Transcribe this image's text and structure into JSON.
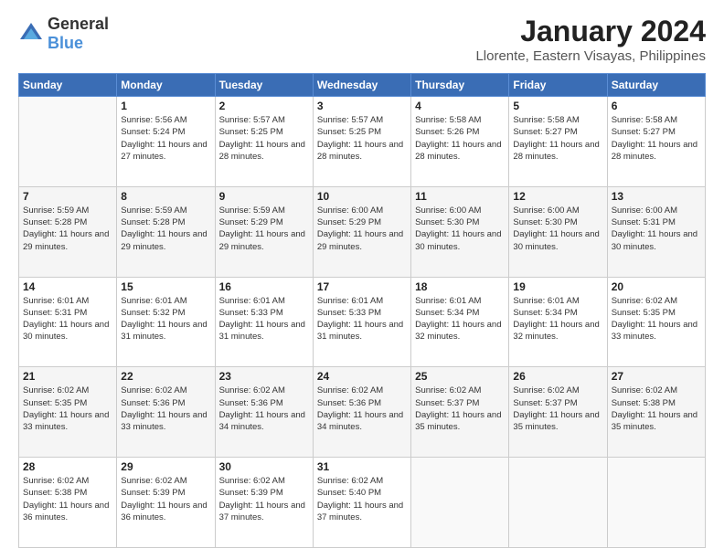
{
  "logo": {
    "general": "General",
    "blue": "Blue"
  },
  "header": {
    "title": "January 2024",
    "location": "Llorente, Eastern Visayas, Philippines"
  },
  "weekdays": [
    "Sunday",
    "Monday",
    "Tuesday",
    "Wednesday",
    "Thursday",
    "Friday",
    "Saturday"
  ],
  "weeks": [
    [
      {
        "day": "",
        "sunrise": "",
        "sunset": "",
        "daylight": ""
      },
      {
        "day": "1",
        "sunrise": "Sunrise: 5:56 AM",
        "sunset": "Sunset: 5:24 PM",
        "daylight": "Daylight: 11 hours and 27 minutes."
      },
      {
        "day": "2",
        "sunrise": "Sunrise: 5:57 AM",
        "sunset": "Sunset: 5:25 PM",
        "daylight": "Daylight: 11 hours and 28 minutes."
      },
      {
        "day": "3",
        "sunrise": "Sunrise: 5:57 AM",
        "sunset": "Sunset: 5:25 PM",
        "daylight": "Daylight: 11 hours and 28 minutes."
      },
      {
        "day": "4",
        "sunrise": "Sunrise: 5:58 AM",
        "sunset": "Sunset: 5:26 PM",
        "daylight": "Daylight: 11 hours and 28 minutes."
      },
      {
        "day": "5",
        "sunrise": "Sunrise: 5:58 AM",
        "sunset": "Sunset: 5:27 PM",
        "daylight": "Daylight: 11 hours and 28 minutes."
      },
      {
        "day": "6",
        "sunrise": "Sunrise: 5:58 AM",
        "sunset": "Sunset: 5:27 PM",
        "daylight": "Daylight: 11 hours and 28 minutes."
      }
    ],
    [
      {
        "day": "7",
        "sunrise": "Sunrise: 5:59 AM",
        "sunset": "Sunset: 5:28 PM",
        "daylight": "Daylight: 11 hours and 29 minutes."
      },
      {
        "day": "8",
        "sunrise": "Sunrise: 5:59 AM",
        "sunset": "Sunset: 5:28 PM",
        "daylight": "Daylight: 11 hours and 29 minutes."
      },
      {
        "day": "9",
        "sunrise": "Sunrise: 5:59 AM",
        "sunset": "Sunset: 5:29 PM",
        "daylight": "Daylight: 11 hours and 29 minutes."
      },
      {
        "day": "10",
        "sunrise": "Sunrise: 6:00 AM",
        "sunset": "Sunset: 5:29 PM",
        "daylight": "Daylight: 11 hours and 29 minutes."
      },
      {
        "day": "11",
        "sunrise": "Sunrise: 6:00 AM",
        "sunset": "Sunset: 5:30 PM",
        "daylight": "Daylight: 11 hours and 30 minutes."
      },
      {
        "day": "12",
        "sunrise": "Sunrise: 6:00 AM",
        "sunset": "Sunset: 5:30 PM",
        "daylight": "Daylight: 11 hours and 30 minutes."
      },
      {
        "day": "13",
        "sunrise": "Sunrise: 6:00 AM",
        "sunset": "Sunset: 5:31 PM",
        "daylight": "Daylight: 11 hours and 30 minutes."
      }
    ],
    [
      {
        "day": "14",
        "sunrise": "Sunrise: 6:01 AM",
        "sunset": "Sunset: 5:31 PM",
        "daylight": "Daylight: 11 hours and 30 minutes."
      },
      {
        "day": "15",
        "sunrise": "Sunrise: 6:01 AM",
        "sunset": "Sunset: 5:32 PM",
        "daylight": "Daylight: 11 hours and 31 minutes."
      },
      {
        "day": "16",
        "sunrise": "Sunrise: 6:01 AM",
        "sunset": "Sunset: 5:33 PM",
        "daylight": "Daylight: 11 hours and 31 minutes."
      },
      {
        "day": "17",
        "sunrise": "Sunrise: 6:01 AM",
        "sunset": "Sunset: 5:33 PM",
        "daylight": "Daylight: 11 hours and 31 minutes."
      },
      {
        "day": "18",
        "sunrise": "Sunrise: 6:01 AM",
        "sunset": "Sunset: 5:34 PM",
        "daylight": "Daylight: 11 hours and 32 minutes."
      },
      {
        "day": "19",
        "sunrise": "Sunrise: 6:01 AM",
        "sunset": "Sunset: 5:34 PM",
        "daylight": "Daylight: 11 hours and 32 minutes."
      },
      {
        "day": "20",
        "sunrise": "Sunrise: 6:02 AM",
        "sunset": "Sunset: 5:35 PM",
        "daylight": "Daylight: 11 hours and 33 minutes."
      }
    ],
    [
      {
        "day": "21",
        "sunrise": "Sunrise: 6:02 AM",
        "sunset": "Sunset: 5:35 PM",
        "daylight": "Daylight: 11 hours and 33 minutes."
      },
      {
        "day": "22",
        "sunrise": "Sunrise: 6:02 AM",
        "sunset": "Sunset: 5:36 PM",
        "daylight": "Daylight: 11 hours and 33 minutes."
      },
      {
        "day": "23",
        "sunrise": "Sunrise: 6:02 AM",
        "sunset": "Sunset: 5:36 PM",
        "daylight": "Daylight: 11 hours and 34 minutes."
      },
      {
        "day": "24",
        "sunrise": "Sunrise: 6:02 AM",
        "sunset": "Sunset: 5:36 PM",
        "daylight": "Daylight: 11 hours and 34 minutes."
      },
      {
        "day": "25",
        "sunrise": "Sunrise: 6:02 AM",
        "sunset": "Sunset: 5:37 PM",
        "daylight": "Daylight: 11 hours and 35 minutes."
      },
      {
        "day": "26",
        "sunrise": "Sunrise: 6:02 AM",
        "sunset": "Sunset: 5:37 PM",
        "daylight": "Daylight: 11 hours and 35 minutes."
      },
      {
        "day": "27",
        "sunrise": "Sunrise: 6:02 AM",
        "sunset": "Sunset: 5:38 PM",
        "daylight": "Daylight: 11 hours and 35 minutes."
      }
    ],
    [
      {
        "day": "28",
        "sunrise": "Sunrise: 6:02 AM",
        "sunset": "Sunset: 5:38 PM",
        "daylight": "Daylight: 11 hours and 36 minutes."
      },
      {
        "day": "29",
        "sunrise": "Sunrise: 6:02 AM",
        "sunset": "Sunset: 5:39 PM",
        "daylight": "Daylight: 11 hours and 36 minutes."
      },
      {
        "day": "30",
        "sunrise": "Sunrise: 6:02 AM",
        "sunset": "Sunset: 5:39 PM",
        "daylight": "Daylight: 11 hours and 37 minutes."
      },
      {
        "day": "31",
        "sunrise": "Sunrise: 6:02 AM",
        "sunset": "Sunset: 5:40 PM",
        "daylight": "Daylight: 11 hours and 37 minutes."
      },
      {
        "day": "",
        "sunrise": "",
        "sunset": "",
        "daylight": ""
      },
      {
        "day": "",
        "sunrise": "",
        "sunset": "",
        "daylight": ""
      },
      {
        "day": "",
        "sunrise": "",
        "sunset": "",
        "daylight": ""
      }
    ]
  ]
}
